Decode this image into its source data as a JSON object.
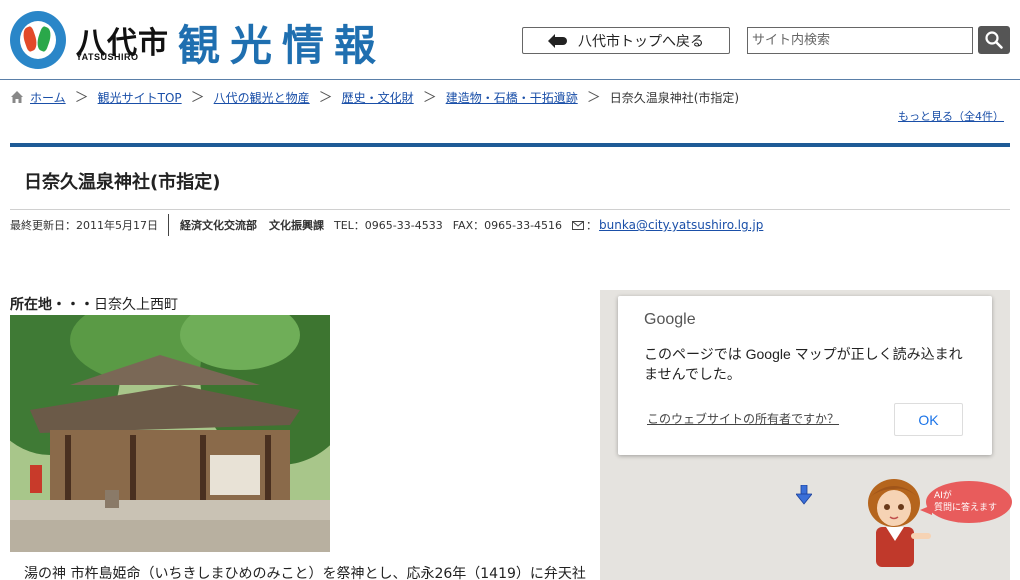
{
  "header": {
    "city_name": "八代市",
    "city_roman": "YATSUSHIRO",
    "site_title": "観光情報",
    "top_button_label": "八代市トップへ戻る",
    "search_placeholder": "サイト内検索"
  },
  "breadcrumb": {
    "items": [
      "ホーム",
      "観光サイトTOP",
      "八代の観光と物産",
      "歴史・文化財",
      "建造物・石橋・干拓遺跡"
    ],
    "current": "日奈久温泉神社(市指定)",
    "separator": "＞",
    "more": "もっと見る（全4件）"
  },
  "page": {
    "title": "日奈久温泉神社(市指定)"
  },
  "meta": {
    "updated": "最終更新日：2011年5月17日",
    "department": "経済文化交流部",
    "section": "文化振興課",
    "tel": "TEL：0965-33-4533",
    "fax": "FAX：0965-33-4516",
    "mail_colon": "：",
    "email": "bunka@city.yatsushiro.lg.jp"
  },
  "content": {
    "location_label": "所在地・・・",
    "location_value": "日奈久上西町",
    "description": "湯の神 市杵島姫命（いちきしまひめのみこと）を祭神とし、応永26年（1419）に弁天社"
  },
  "map": {
    "logo": "Google",
    "message": "このページでは Google マップが正しく読み込まれませんでした。",
    "owner_link": "このウェブサイトの所有者ですか？",
    "ok_label": "OK"
  },
  "ai_widget": {
    "line1": "AIが",
    "line2": "質問に答えます"
  },
  "colors": {
    "title_blue": "#1f6fb0",
    "rule_blue": "#1e5b96",
    "link_blue": "#1a4fa8",
    "bubble_red": "#e85c5c"
  }
}
